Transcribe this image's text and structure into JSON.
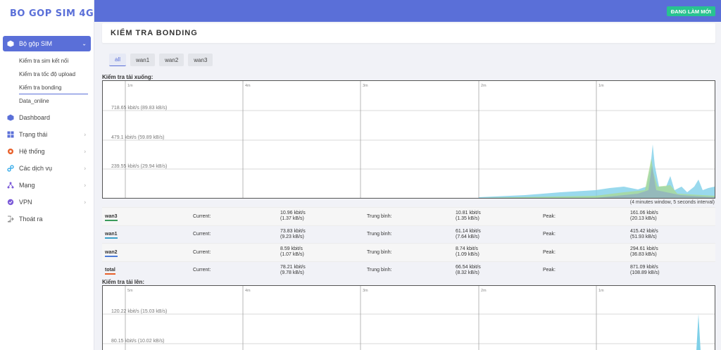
{
  "app": {
    "logo": "BO GOP SIM 4G"
  },
  "header": {
    "update_button": "ĐANG LÀM MỚI"
  },
  "sidebar": {
    "group": {
      "label": "Bộ gộp SIM",
      "icon": "cube-icon"
    },
    "subitems": [
      {
        "label": "Kiểm tra sim kết nối"
      },
      {
        "label": "Kiểm tra tốc độ upload"
      },
      {
        "label": "Kiểm tra bonding"
      },
      {
        "label": "Data_online"
      }
    ],
    "items": [
      {
        "label": "Dashboard",
        "icon": "cube-icon",
        "color": "#5a6fd8",
        "chevron": false
      },
      {
        "label": "Trạng thái",
        "icon": "grid-icon",
        "color": "#5a6fd8",
        "chevron": true
      },
      {
        "label": "Hệ thống",
        "icon": "gear-icon",
        "color": "#e8602a",
        "chevron": true
      },
      {
        "label": "Các dịch vụ",
        "icon": "link-icon",
        "color": "#2aa6e8",
        "chevron": true
      },
      {
        "label": "Mạng",
        "icon": "network-icon",
        "color": "#7b5ad8",
        "chevron": true
      },
      {
        "label": "VPN",
        "icon": "vpn-icon",
        "color": "#7b5ad8",
        "chevron": true
      },
      {
        "label": "Thoát ra",
        "icon": "logout-icon",
        "color": "#888888",
        "chevron": false
      }
    ]
  },
  "page": {
    "title": "KIỂM TRA BONDING"
  },
  "tabs": [
    "all",
    "wan1",
    "wan2",
    "wan3"
  ],
  "download": {
    "label": "Kiểm tra tải xuống:",
    "time_labels": [
      "1m",
      "4m",
      "3m",
      "2m",
      "1m"
    ],
    "y_labels": [
      "718.65 kbit/s (89.83 kB/s)",
      "479.1 kbit/s (59.89 kB/s)",
      "239.55 kbit/s (29.94 kB/s)"
    ],
    "note": "(4 minutes window, 5 seconds interval)"
  },
  "upload": {
    "label": "Kiểm tra tải lên:",
    "time_labels": [
      "5m",
      "4m",
      "3m",
      "2m",
      "1m"
    ],
    "y_labels": [
      "120.22 kbit/s (15.03 kB/s)",
      "80.15 kbit/s (10.02 kB/s)"
    ]
  },
  "stats": {
    "current_label": "Current:",
    "avg_label": "Trung bình:",
    "peak_label": "Peak:",
    "rows": [
      {
        "name": "wan3",
        "color": "#3a9a5a",
        "current": [
          "10.96 kbit/s",
          "(1.37 kB/s)"
        ],
        "avg": [
          "10.81 kbit/s",
          "(1.35 kB/s)"
        ],
        "peak": [
          "161.06 kbit/s",
          "(20.13 kB/s)"
        ]
      },
      {
        "name": "wan1",
        "color": "#3aa0c8",
        "current": [
          "73.83 kbit/s",
          "(9.23 kB/s)"
        ],
        "avg": [
          "61.14 kbit/s",
          "(7.64 kB/s)"
        ],
        "peak": [
          "415.42 kbit/s",
          "(51.93 kB/s)"
        ]
      },
      {
        "name": "wan2",
        "color": "#4a7ad8",
        "current": [
          "8.59 kbit/s",
          "(1.07 kB/s)"
        ],
        "avg": [
          "8.74 kbit/s",
          "(1.09 kB/s)"
        ],
        "peak": [
          "294.61 kbit/s",
          "(36.83 kB/s)"
        ]
      },
      {
        "name": "total",
        "color": "#e8602a",
        "current": [
          "78.21 kbit/s",
          "(9.78 kB/s)"
        ],
        "avg": [
          "66.54 kbit/s",
          "(8.32 kB/s)"
        ],
        "peak": [
          "871.09 kbit/s",
          "(108.89 kB/s)"
        ]
      }
    ]
  }
}
